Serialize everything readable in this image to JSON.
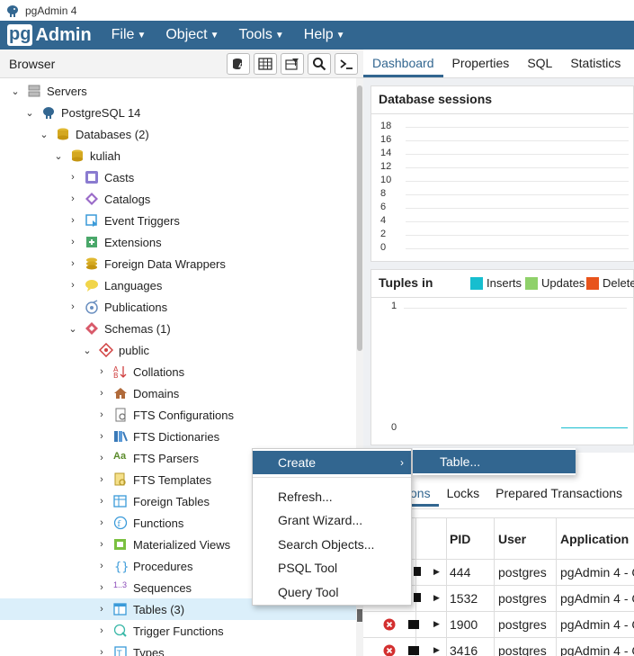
{
  "window": {
    "title": "pgAdmin 4"
  },
  "menubar": {
    "logo_pg": "pg",
    "logo_admin": "Admin",
    "items": [
      {
        "label": "File"
      },
      {
        "label": "Object"
      },
      {
        "label": "Tools"
      },
      {
        "label": "Help"
      }
    ]
  },
  "browser": {
    "title": "Browser",
    "tree": [
      {
        "label": "Servers",
        "icon": "servers-icon"
      },
      {
        "label": "PostgreSQL 14",
        "icon": "elephant-icon"
      },
      {
        "label": "Databases (2)",
        "icon": "databases-icon"
      },
      {
        "label": "kuliah",
        "icon": "database-icon"
      },
      {
        "label": "Casts",
        "icon": "casts-icon"
      },
      {
        "label": "Catalogs",
        "icon": "catalogs-icon"
      },
      {
        "label": "Event Triggers",
        "icon": "event-trigger-icon"
      },
      {
        "label": "Extensions",
        "icon": "extensions-icon"
      },
      {
        "label": "Foreign Data Wrappers",
        "icon": "fdw-icon"
      },
      {
        "label": "Languages",
        "icon": "languages-icon"
      },
      {
        "label": "Publications",
        "icon": "publications-icon"
      },
      {
        "label": "Schemas (1)",
        "icon": "schemas-icon"
      },
      {
        "label": "public",
        "icon": "schema-icon"
      },
      {
        "label": "Collations",
        "icon": "collations-icon"
      },
      {
        "label": "Domains",
        "icon": "domains-icon"
      },
      {
        "label": "FTS Configurations",
        "icon": "fts-config-icon"
      },
      {
        "label": "FTS Dictionaries",
        "icon": "fts-dict-icon"
      },
      {
        "label": "FTS Parsers",
        "icon": "fts-parser-icon",
        "prefix": "Aa"
      },
      {
        "label": "FTS Templates",
        "icon": "fts-template-icon"
      },
      {
        "label": "Foreign Tables",
        "icon": "foreign-table-icon"
      },
      {
        "label": "Functions",
        "icon": "functions-icon"
      },
      {
        "label": "Materialized Views",
        "icon": "mat-view-icon"
      },
      {
        "label": "Procedures",
        "icon": "procedures-icon"
      },
      {
        "label": "Sequences",
        "icon": "sequences-icon",
        "prefix": "1..3"
      },
      {
        "label": "Tables (3)",
        "icon": "tables-icon"
      },
      {
        "label": "Trigger Functions",
        "icon": "trigger-functions-icon"
      },
      {
        "label": "Types",
        "icon": "types-icon"
      }
    ]
  },
  "right_tabs": [
    {
      "label": "Dashboard"
    },
    {
      "label": "Properties"
    },
    {
      "label": "SQL"
    },
    {
      "label": "Statistics"
    }
  ],
  "sessions_panel": {
    "title": "Database sessions",
    "yticks": [
      "18",
      "16",
      "14",
      "12",
      "10",
      "8",
      "6",
      "4",
      "2",
      "0"
    ]
  },
  "tuples_panel": {
    "title": "Tuples in",
    "legend": [
      {
        "label": "Inserts",
        "color": "#17becf"
      },
      {
        "label": "Updates",
        "color": "#8fd16a"
      },
      {
        "label": "Delete",
        "color": "#e8541c"
      }
    ],
    "yticks": [
      "1",
      "0"
    ]
  },
  "activity_tabs": [
    {
      "label": "ons"
    },
    {
      "label": "Locks"
    },
    {
      "label": "Prepared Transactions"
    }
  ],
  "activity_table": {
    "headers": [
      "PID",
      "User",
      "Application"
    ],
    "rows": [
      {
        "pid": "444",
        "user": "postgres",
        "app": "pgAdmin 4 - C"
      },
      {
        "pid": "1532",
        "user": "postgres",
        "app": "pgAdmin 4 - C"
      },
      {
        "pid": "1900",
        "user": "postgres",
        "app": "pgAdmin 4 - C"
      },
      {
        "pid": "3416",
        "user": "postgres",
        "app": "pgAdmin 4 - C"
      }
    ]
  },
  "context_menu": {
    "create": "Create",
    "items": [
      {
        "label": "Refresh..."
      },
      {
        "label": "Grant Wizard..."
      },
      {
        "label": "Search Objects..."
      },
      {
        "label": "PSQL Tool"
      },
      {
        "label": "Query Tool"
      }
    ],
    "submenu_table": "Table..."
  },
  "colors": {
    "brand": "#326690",
    "selected_row": "#dbeffa"
  }
}
